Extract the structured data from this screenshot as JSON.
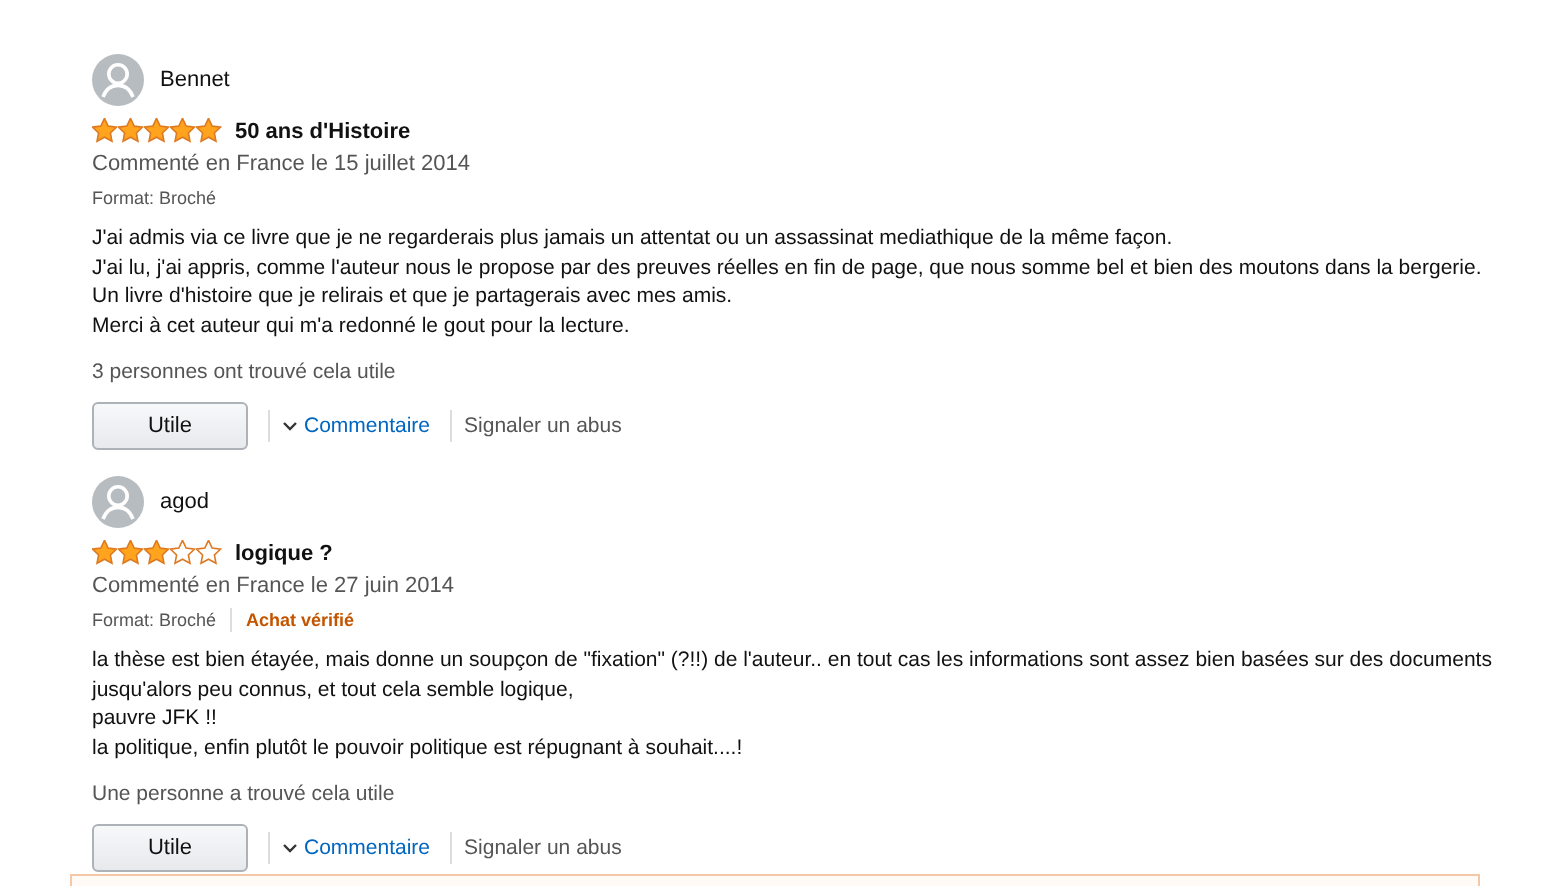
{
  "reviews": [
    {
      "author": "Bennet",
      "stars": 5,
      "title": "50 ans d'Histoire",
      "date": "Commenté en France le 15 juillet 2014",
      "format": "Format: Broché",
      "body": [
        "J'ai admis via ce livre que je ne regarderais plus jamais un attentat ou un assassinat mediathique de la même façon.",
        "J'ai lu, j'ai appris, comme l'auteur nous le propose par des preuves réelles en fin de page, que nous somme bel et bien des moutons dans la bergerie.",
        "Un livre d'histoire que je relirais et que je partagerais avec mes amis.",
        "Merci à cet auteur qui m'a redonné le gout pour la lecture."
      ],
      "helpful": "3 personnes ont trouvé cela utile",
      "helpful_button": "Utile",
      "comment_link": "Commentaire",
      "report_link": "Signaler un abus"
    },
    {
      "author": "agod",
      "stars": 3,
      "title": "logique ?",
      "date": "Commenté en France le 27 juin 2014",
      "format": "Format: Broché",
      "verified": "Achat vérifié",
      "body": [
        "la thèse est bien étayée, mais donne un soupçon de \"fixation\" (?!!) de l'auteur.. en tout cas les informations sont assez bien basées sur des documents jusqu'alors peu connus, et tout cela semble logique,",
        "pauvre JFK !!",
        "la politique, enfin plutôt le pouvoir politique est répugnant à souhait....!"
      ],
      "helpful": "Une personne a trouvé cela utile",
      "helpful_button": "Utile",
      "comment_link": "Commentaire",
      "report_link": "Signaler un abus"
    }
  ]
}
